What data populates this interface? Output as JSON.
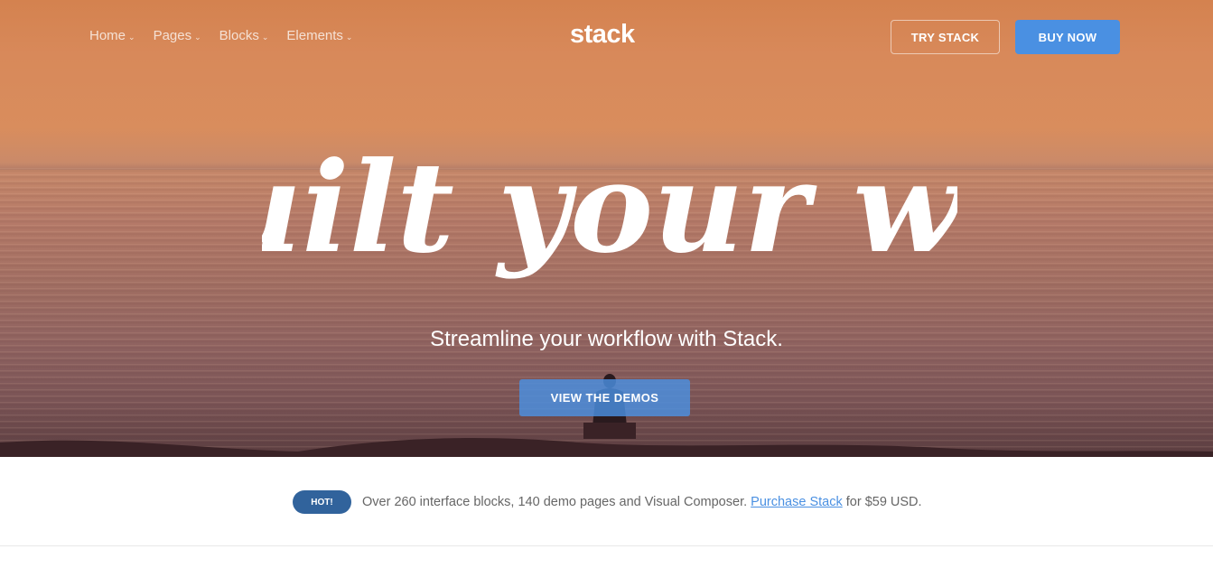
{
  "nav": {
    "items": [
      {
        "label": "Home"
      },
      {
        "label": "Pages"
      },
      {
        "label": "Blocks"
      },
      {
        "label": "Elements"
      }
    ],
    "caret": "⌄"
  },
  "brand": {
    "logo": "stack"
  },
  "header_buttons": {
    "try_label": "TRY STACK",
    "buy_label": "BUY NOW"
  },
  "hero": {
    "headline": "Built your way",
    "subtitle": "Streamline your workflow with Stack.",
    "cta_label": "VIEW THE DEMOS"
  },
  "notice": {
    "badge": "HOT!",
    "text_before": "Over 260 interface blocks, 140 demo pages and Visual Composer. ",
    "link_text": "Purchase Stack",
    "text_after": " for $59 USD."
  },
  "colors": {
    "accent": "#4a90e2",
    "badge": "#31639c",
    "sunset": "#d4824f"
  }
}
